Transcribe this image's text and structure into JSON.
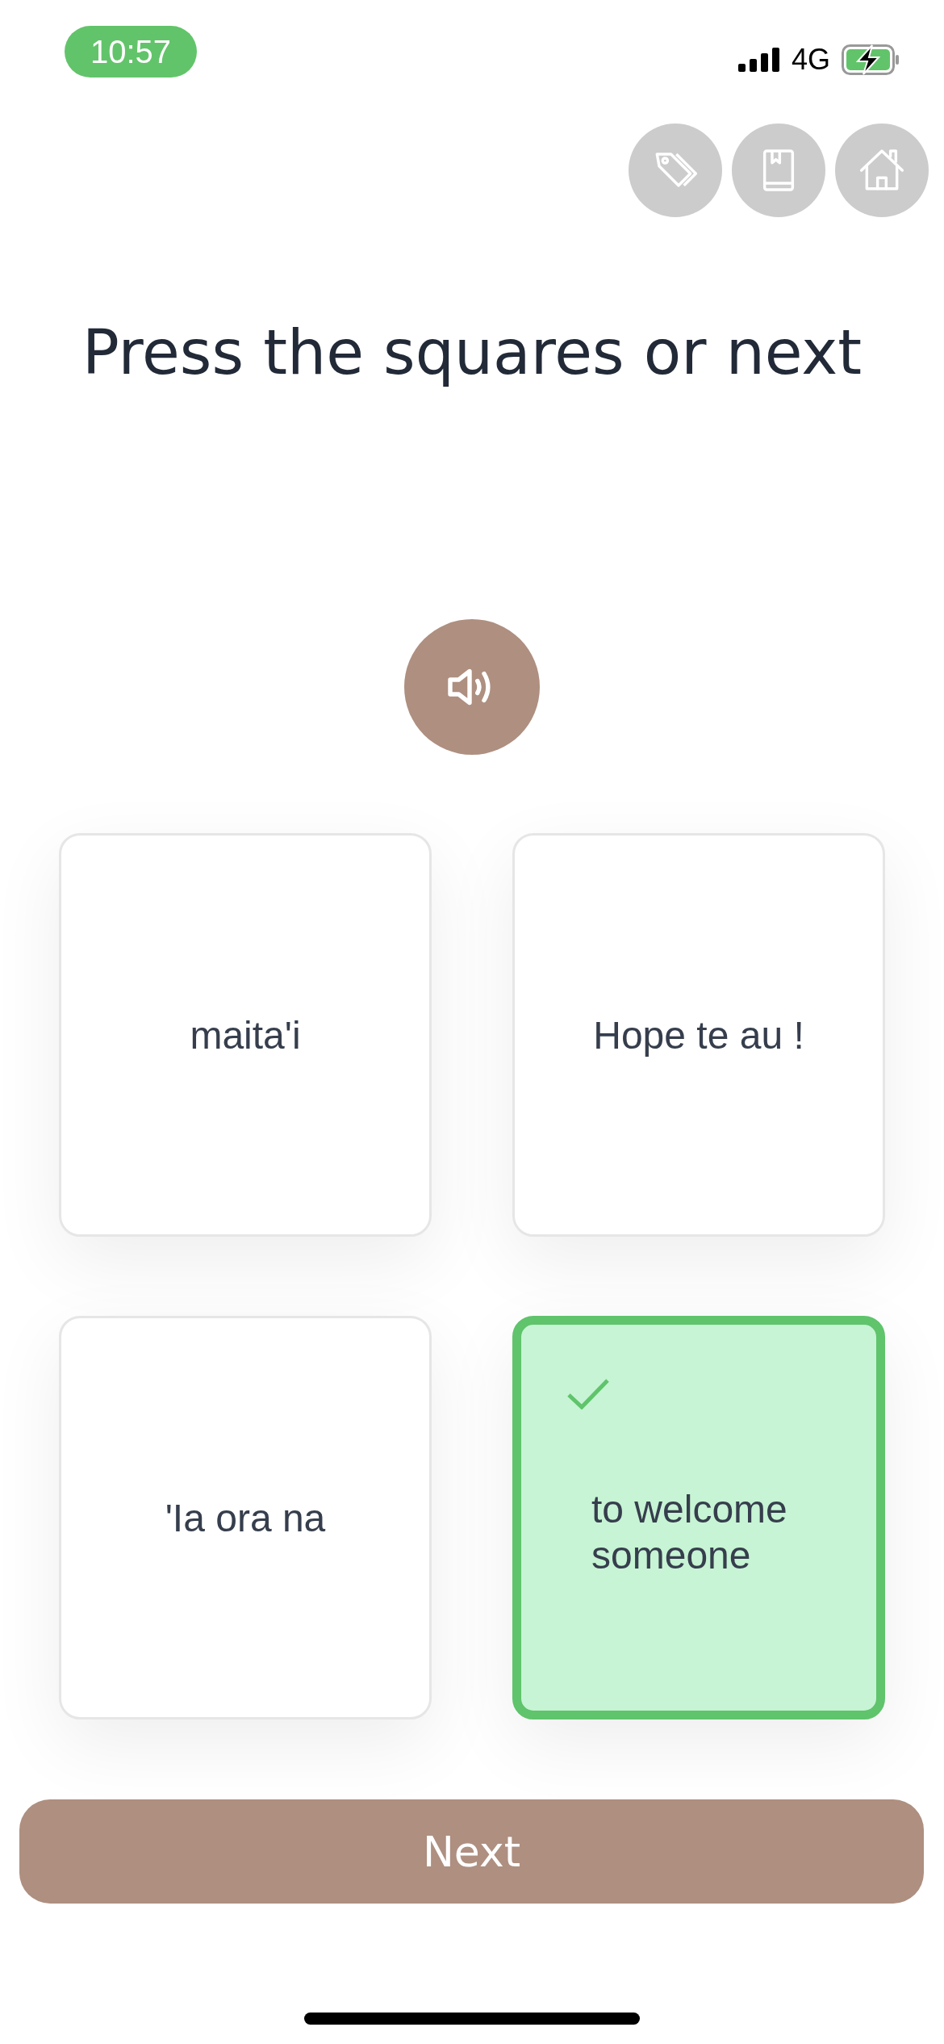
{
  "status_bar": {
    "time": "10:57",
    "network": "4G"
  },
  "title": "Press the squares or next",
  "cards": [
    {
      "text": "maita'i",
      "selected": false
    },
    {
      "text": "Hope te au !",
      "selected": false
    },
    {
      "text": "'Ia ora na",
      "selected": false
    },
    {
      "text": "to welcome someone",
      "selected": true
    }
  ],
  "next_button": {
    "label": "Next"
  }
}
